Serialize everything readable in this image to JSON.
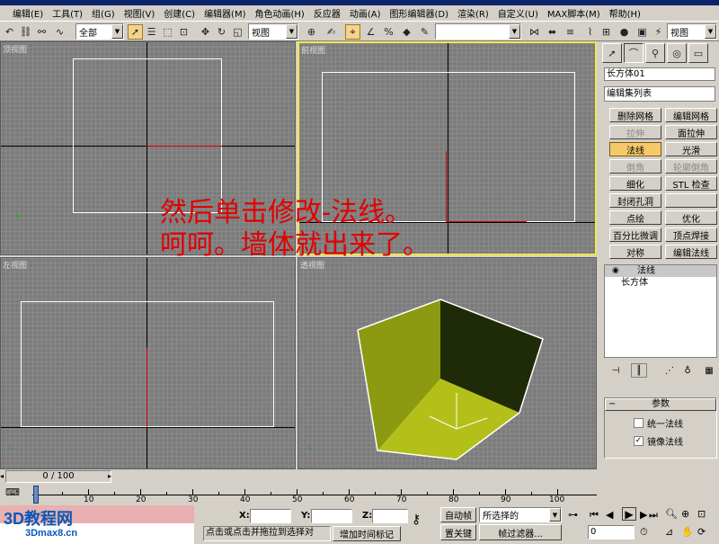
{
  "menu": [
    "编辑(E)",
    "工具(T)",
    "组(G)",
    "视图(V)",
    "创建(C)",
    "编辑器(M)",
    "角色动画(H)",
    "反应器",
    "动画(A)",
    "图形编辑器(D)",
    "渲染(R)",
    "自定义(U)",
    "MAX脚本(M)",
    "帮助(H)"
  ],
  "toolbar": {
    "selection_filter": "全部",
    "coord_system": "视图",
    "named_selection": "",
    "viewport_combo": "视图"
  },
  "viewports": {
    "top": "顶视图",
    "front": "前视图",
    "left": "左视图",
    "perspective": "透视图"
  },
  "overlay": {
    "line1": "然后单击修改-法线。",
    "line2": "呵呵。墙体就出来了。"
  },
  "panel": {
    "object_name": "长方体01",
    "modifier_list": "编辑集列表",
    "buttons": [
      [
        "删除网格",
        "编辑网格"
      ],
      [
        "拉伸",
        "面拉伸"
      ],
      [
        "法线",
        "光滑"
      ],
      [
        "倒角",
        "轮廓倒角"
      ],
      [
        "细化",
        "STL 检查"
      ],
      [
        "封闭孔洞",
        ""
      ],
      [
        "点绘",
        "优化"
      ],
      [
        "百分比微调",
        "顶点焊接"
      ],
      [
        "对称",
        "编辑法线"
      ]
    ],
    "stack": [
      "法线",
      "长方体"
    ],
    "rollout_title": "参数",
    "checkbox1": "统一法线",
    "checkbox2": "镜像法线",
    "checkbox2_checked": "✓"
  },
  "timeline": {
    "frame": "0 / 100",
    "ticks": [
      "0",
      "10",
      "20",
      "30",
      "40",
      "50",
      "60",
      "70",
      "80",
      "90",
      "100"
    ]
  },
  "status": {
    "x_label": "X:",
    "y_label": "Y:",
    "z_label": "Z:",
    "prompt": "点击或点击并拖拉到选择对",
    "add_time_tag": "增加时间标记",
    "auto_key": "自动帧",
    "set_key": "置关键",
    "selected": "所选择的",
    "key_filters": "帧过滤器...",
    "current_frame": "0",
    "logo_top": "3D教程网",
    "logo_bottom": "3Dmax8.cn"
  }
}
